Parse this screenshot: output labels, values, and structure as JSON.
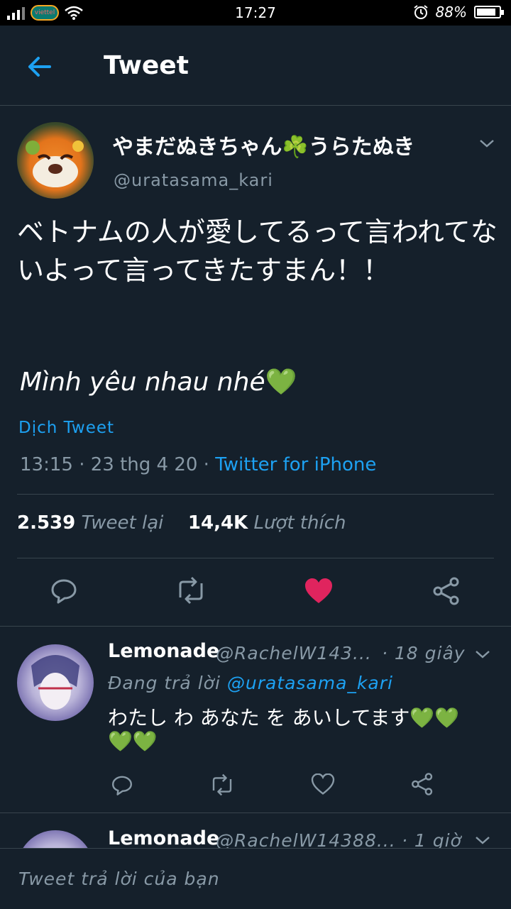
{
  "status": {
    "time": "17:27",
    "battery": "88%",
    "carrier": "viettel",
    "battery_level": 0.88
  },
  "header": {
    "title": "Tweet"
  },
  "tweet": {
    "name": "やまだぬきちゃん☘️うらたぬき",
    "handle": "@uratasama_kari",
    "text_jp": "ベトナムの人が愛してるって言われてないよって言ってきたすまん！！",
    "text_vn": "Mình yêu nhau nhé",
    "emoji": "💚",
    "translate": "Dịch Tweet",
    "meta_time": "13:15 · 23 thg 4 20 · ",
    "meta_source": "Twitter for iPhone",
    "retweets": "2.539",
    "retweets_label": "Tweet lại",
    "likes": "14,4K",
    "likes_label": "Lượt thích"
  },
  "replies": [
    {
      "name": "Lemonade",
      "handle": "@RachelW143...",
      "time": "· 18 giây",
      "replying_prefix": "Đang trả lời ",
      "replying_to": "@uratasama_kari",
      "text_line1": "わたし わ あなた を あいしてます💚💚",
      "text_line2": "💚💚"
    },
    {
      "name": "Lemonade",
      "handle": "@RachelW14388...",
      "time": "· 1 giờ"
    }
  ],
  "compose": {
    "placeholder": "Tweet trả lời của bạn"
  },
  "colors": {
    "bg": "#15202b",
    "accent": "#1da1f2",
    "like": "#e0245e",
    "muted": "#8899a6",
    "divider": "#38444d"
  },
  "icons": [
    "back-arrow-icon",
    "chevron-down-icon",
    "reply-icon",
    "retweet-icon",
    "like-icon",
    "share-icon",
    "wifi-icon",
    "alarm-icon",
    "battery-icon",
    "signal-icon"
  ]
}
